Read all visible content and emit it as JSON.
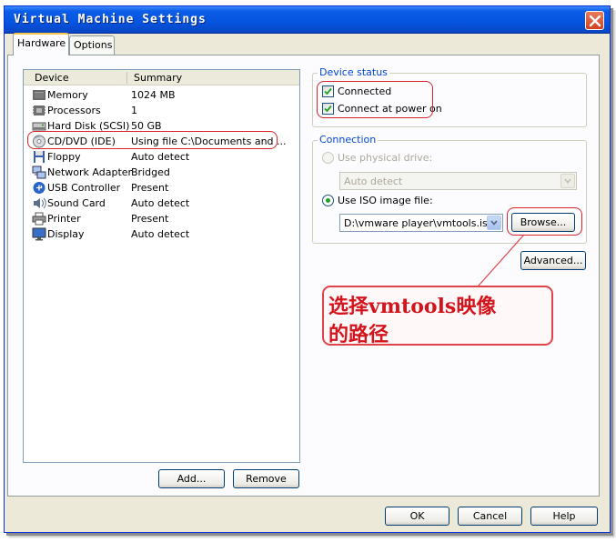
{
  "window": {
    "title": "Virtual Machine Settings"
  },
  "tabs": [
    {
      "label": "Hardware"
    },
    {
      "label": "Options"
    }
  ],
  "device_list": {
    "headers": {
      "device": "Device",
      "summary": "Summary"
    },
    "rows": [
      {
        "device": "Memory",
        "summary": "1024 MB",
        "icon": "memory-icon"
      },
      {
        "device": "Processors",
        "summary": "1",
        "icon": "processor-icon"
      },
      {
        "device": "Hard Disk (SCSI)",
        "summary": "50 GB",
        "icon": "hard-disk-icon"
      },
      {
        "device": "CD/DVD (IDE)",
        "summary": "Using file C:\\Documents and ...",
        "icon": "cd-dvd-icon"
      },
      {
        "device": "Floppy",
        "summary": "Auto detect",
        "icon": "floppy-icon"
      },
      {
        "device": "Network Adapter",
        "summary": "Bridged",
        "icon": "network-adapter-icon"
      },
      {
        "device": "USB Controller",
        "summary": "Present",
        "icon": "usb-icon"
      },
      {
        "device": "Sound Card",
        "summary": "Auto detect",
        "icon": "sound-card-icon"
      },
      {
        "device": "Printer",
        "summary": "Present",
        "icon": "printer-icon"
      },
      {
        "device": "Display",
        "summary": "Auto detect",
        "icon": "display-icon"
      }
    ],
    "add_label": "Add...",
    "remove_label": "Remove"
  },
  "device_status": {
    "title": "Device status",
    "connected_label": "Connected",
    "connected_checked": true,
    "connect_power_on_label": "Connect at power on",
    "connect_power_on_checked": true
  },
  "connection": {
    "title": "Connection",
    "use_physical_label": "Use physical drive:",
    "physical_value": "Auto detect",
    "use_iso_label": "Use ISO image file:",
    "iso_value": "D:\\vmware player\\vmtools.iso",
    "browse_label": "Browse...",
    "selected": "iso"
  },
  "advanced_label": "Advanced...",
  "annotation": {
    "line1": "选择vmtools映像",
    "line2": "的路径",
    "color": "#d4141c"
  },
  "footer": {
    "ok_label": "OK",
    "cancel_label": "Cancel",
    "help_label": "Help"
  }
}
